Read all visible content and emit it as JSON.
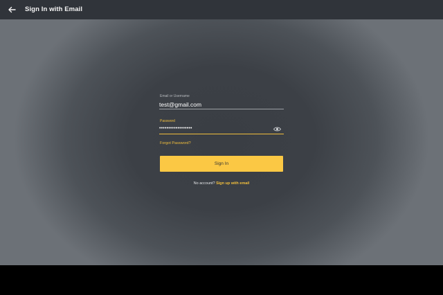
{
  "header": {
    "back_icon": "arrow-left-icon",
    "title": "Sign In with Email"
  },
  "form": {
    "email_label": "Email or Username",
    "email_value": "test@gmail.com",
    "password_label": "Password",
    "password_value": "••••••••••••••••••",
    "password_toggle_icon": "eye-icon",
    "forgot_password": "Forgot Password?",
    "sign_in_button": "Sign In"
  },
  "footer": {
    "no_account_text": "No account?",
    "signup_link": "Sign up with email"
  },
  "colors": {
    "accent": "#f2bf3c",
    "button": "#fbc844",
    "topbar": "#30343a"
  }
}
